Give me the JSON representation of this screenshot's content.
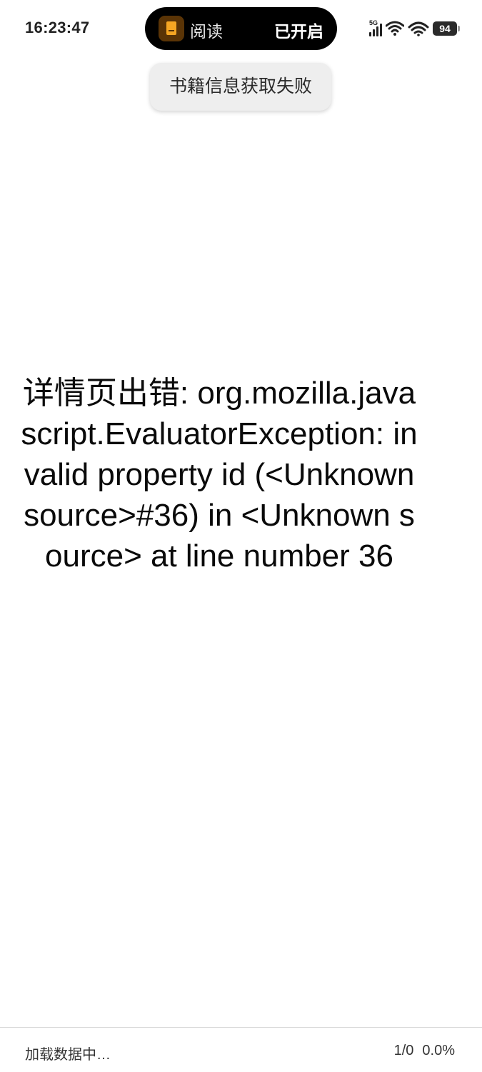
{
  "status_bar": {
    "time": "16:23:47",
    "island": {
      "app_icon": "book-icon",
      "app_name": "阅读",
      "state": "已开启"
    },
    "network": "5G",
    "icons": [
      "signal-icon",
      "wifi-icon",
      "hotspot-wifi-icon",
      "battery-icon"
    ],
    "battery": "94"
  },
  "toast": {
    "message": "书籍信息获取失败"
  },
  "content": {
    "error_message": "详情页出错: org.mozilla.javascript.EvaluatorException: invalid property id (<Unknown source>#36) in <Unknown source> at line number 36"
  },
  "footer": {
    "loading": "加载数据中…",
    "page": "1/0",
    "progress": "0.0%"
  }
}
